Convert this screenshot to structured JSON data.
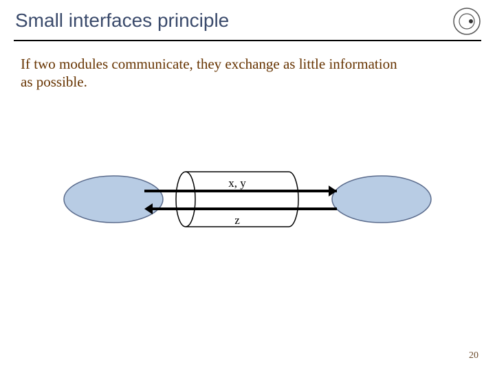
{
  "title": "Small interfaces principle",
  "body": "If two modules communicate, they exchange as little information as possible.",
  "diagram": {
    "label_top": "x, y",
    "label_bottom": "z"
  },
  "page_number": "20"
}
